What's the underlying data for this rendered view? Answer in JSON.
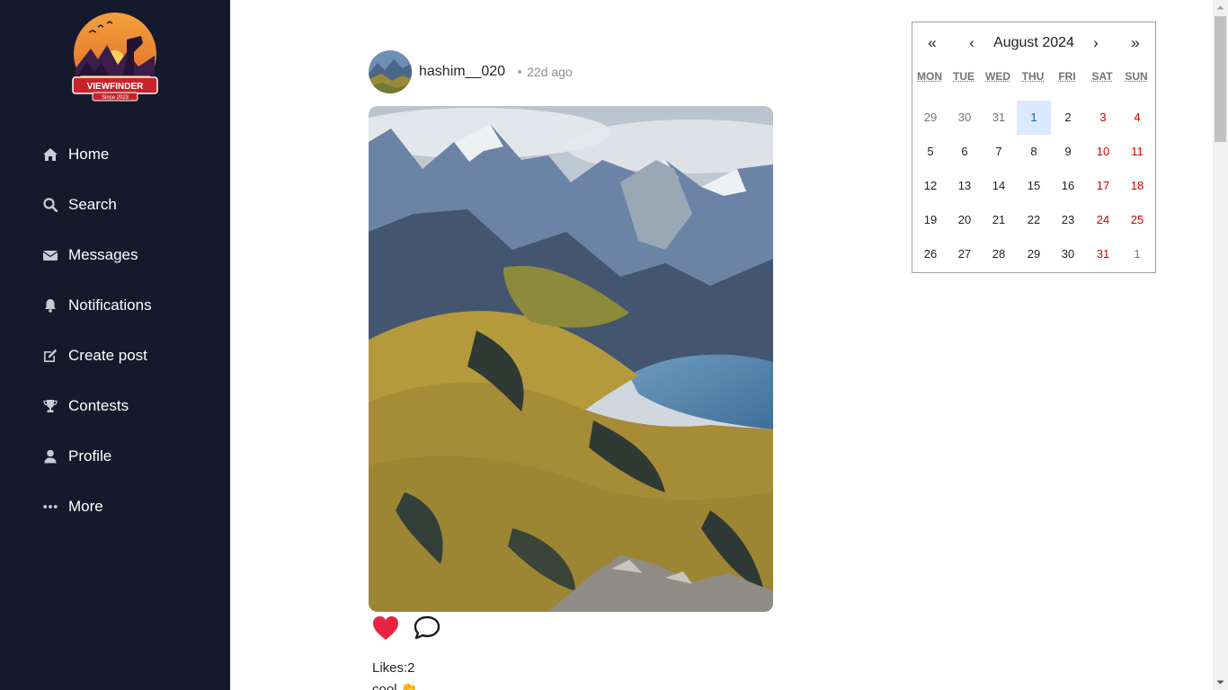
{
  "brand": {
    "logo_text": "VIEWFINDER",
    "logo_subtext": "Since 2023",
    "colors": {
      "sidebar_bg": "#141a2b",
      "accent_orange": "#e8792a",
      "heart": "#e8233f"
    }
  },
  "sidebar": {
    "items": [
      {
        "label": "Home",
        "icon": "home-icon"
      },
      {
        "label": "Search",
        "icon": "search-icon"
      },
      {
        "label": "Messages",
        "icon": "envelope-icon"
      },
      {
        "label": "Notifications",
        "icon": "bell-icon"
      },
      {
        "label": "Create post",
        "icon": "edit-icon"
      },
      {
        "label": "Contests",
        "icon": "trophy-icon"
      },
      {
        "label": "Profile",
        "icon": "user-icon"
      },
      {
        "label": "More",
        "icon": "more-dots-icon"
      }
    ]
  },
  "post": {
    "username": "hashim__020",
    "time_ago": "22d ago",
    "likes_text": "Likes:2",
    "caption": "cool 👏",
    "liked": true
  },
  "calendar": {
    "first_label": "«",
    "prev_label": "‹",
    "title": "August 2024",
    "next_label": "›",
    "last_label": "»",
    "weekdays": [
      "MON",
      "TUE",
      "WED",
      "THU",
      "FRI",
      "SAT",
      "SUN"
    ],
    "weeks": [
      [
        [
          "29",
          "other"
        ],
        [
          "30",
          "other"
        ],
        [
          "31",
          "other"
        ],
        [
          "1",
          "today"
        ],
        [
          "2",
          ""
        ],
        [
          "3",
          "weekend"
        ],
        [
          "4",
          "weekend"
        ]
      ],
      [
        [
          "5",
          ""
        ],
        [
          "6",
          ""
        ],
        [
          "7",
          ""
        ],
        [
          "8",
          ""
        ],
        [
          "9",
          ""
        ],
        [
          "10",
          "weekend"
        ],
        [
          "11",
          "weekend"
        ]
      ],
      [
        [
          "12",
          ""
        ],
        [
          "13",
          ""
        ],
        [
          "14",
          ""
        ],
        [
          "15",
          ""
        ],
        [
          "16",
          ""
        ],
        [
          "17",
          "weekend"
        ],
        [
          "18",
          "weekend"
        ]
      ],
      [
        [
          "19",
          ""
        ],
        [
          "20",
          ""
        ],
        [
          "21",
          ""
        ],
        [
          "22",
          ""
        ],
        [
          "23",
          ""
        ],
        [
          "24",
          "weekend"
        ],
        [
          "25",
          "weekend"
        ]
      ],
      [
        [
          "26",
          ""
        ],
        [
          "27",
          ""
        ],
        [
          "28",
          ""
        ],
        [
          "29",
          ""
        ],
        [
          "30",
          ""
        ],
        [
          "31",
          "weekend"
        ],
        [
          "1",
          "other"
        ]
      ]
    ]
  }
}
